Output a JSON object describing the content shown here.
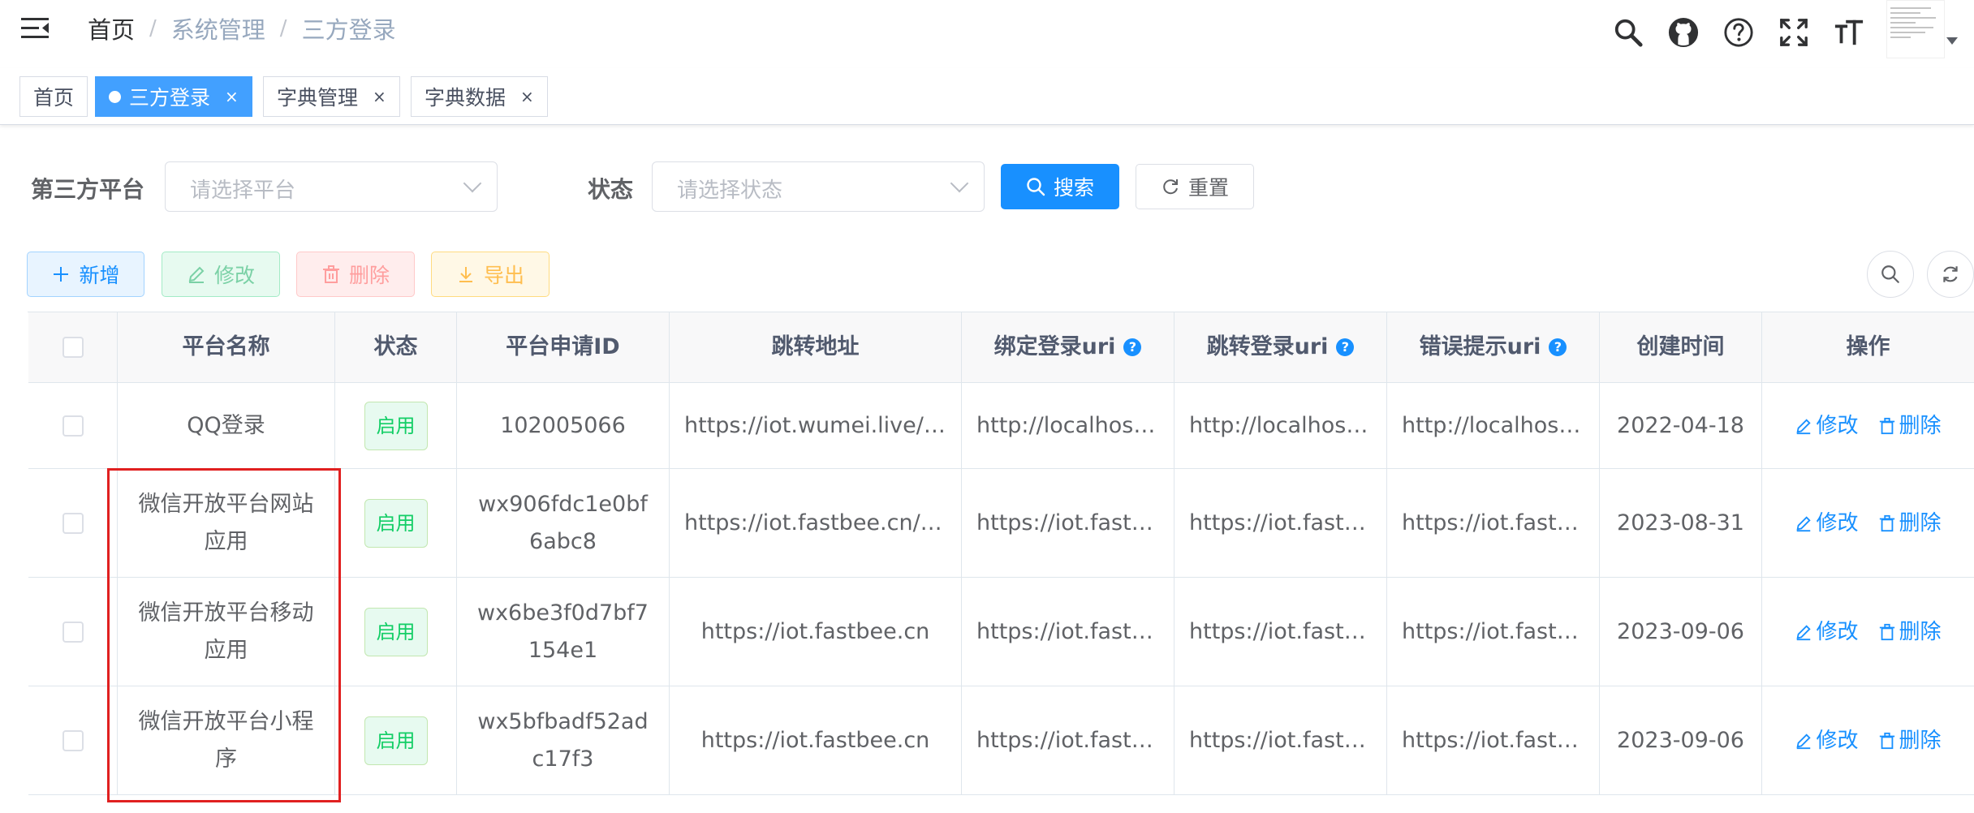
{
  "navbar": {
    "breadcrumb": [
      "首页",
      "系统管理",
      "三方登录"
    ]
  },
  "tags": [
    {
      "label": "首页"
    },
    {
      "label": "三方登录",
      "close": "×"
    },
    {
      "label": "字典管理",
      "close": "×"
    },
    {
      "label": "字典数据",
      "close": "×"
    }
  ],
  "search": {
    "platform_label": "第三方平台",
    "platform_placeholder": "请选择平台",
    "status_label": "状态",
    "status_placeholder": "请选择状态",
    "search_button": "搜索",
    "reset_button": "重置"
  },
  "toolbar": {
    "add": "新增",
    "edit": "修改",
    "delete": "删除",
    "export": "导出"
  },
  "table": {
    "headers": {
      "name": "平台名称",
      "status": "状态",
      "app_id": "平台申请ID",
      "redirect": "跳转地址",
      "bind_uri": "绑定登录uri",
      "redirect_login_uri": "跳转登录uri",
      "error_uri": "错误提示uri",
      "created": "创建时间",
      "ops": "操作"
    },
    "rows": [
      {
        "name": "QQ登录",
        "status": "启用",
        "app_id": "102005066",
        "redirect": "https://iot.wumei.live/a…",
        "bind_uri": "http://localhost/…",
        "redirect_login_uri": "http://localhost/…",
        "error_uri": "http://localhost/…",
        "created": "2022-04-18"
      },
      {
        "name": "微信开放平台网站应用",
        "status": "启用",
        "app_id": "wx906fdc1e0bf6abc8",
        "redirect": "https://iot.fastbee.cn/pr…",
        "bind_uri": "https://iot.fastb…",
        "redirect_login_uri": "https://iot.fastb…",
        "error_uri": "https://iot.fastb…",
        "created": "2023-08-31"
      },
      {
        "name": "微信开放平台移动应用",
        "status": "启用",
        "app_id": "wx6be3f0d7bf7154e1",
        "redirect": "https://iot.fastbee.cn",
        "bind_uri": "https://iot.fastb…",
        "redirect_login_uri": "https://iot.fastb…",
        "error_uri": "https://iot.fastb…",
        "created": "2023-09-06"
      },
      {
        "name": "微信开放平台小程序",
        "status": "启用",
        "app_id": "wx5bfbadf52adc17f3",
        "redirect": "https://iot.fastbee.cn",
        "bind_uri": "https://iot.fastb…",
        "redirect_login_uri": "https://iot.fastb…",
        "error_uri": "https://iot.fastb…",
        "created": "2023-09-06"
      }
    ],
    "op_edit": "修改",
    "op_delete": "删除"
  },
  "icons": {
    "hamburger": "hamburger-icon",
    "search": "search-icon",
    "github": "github-icon",
    "help": "question-icon",
    "fullscreen": "fullscreen-icon",
    "font_size": "font-size-icon"
  },
  "colors": {
    "primary": "#1890ff",
    "active_tag": "#42a0ff",
    "success": "#13ce66",
    "highlight": "#e02020"
  }
}
